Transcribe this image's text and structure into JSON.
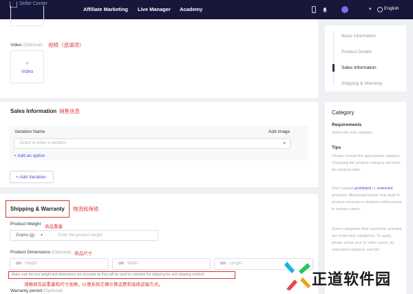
{
  "topnav": {
    "brand": "Seller Center",
    "links": [
      "Affiliate Marketing",
      "Live Manager",
      "Academy"
    ],
    "language": "English"
  },
  "video": {
    "label": "Video",
    "optional": "(Optional)",
    "cn_note": "视频（选填项）",
    "upload_plus": "+",
    "upload_label": "Video"
  },
  "sales": {
    "title": "Sales Information",
    "cn_note": "销售信息",
    "variation_name": "Variation Name",
    "add_image": "Add image",
    "select_placeholder": "Select or enter a variation",
    "add_option": "+ Add an option",
    "add_variation": "+ Add Variation"
  },
  "shipping": {
    "title": "Shipping & Warranty",
    "cn_title": "物流和保修",
    "weight_label": "Product Weight",
    "weight_cn": "商品重量",
    "weight_unit": "Grams (g)",
    "weight_placeholder": "Enter the product weight",
    "dims_label": "Product Dimensions",
    "dims_optional": "(Optional)",
    "dims_cn": "商品尺寸",
    "unit": "cm",
    "height": "Height",
    "width": "Width",
    "length": "Length",
    "warning": "Make sure the box weight and dimensions are accurate as they will be used to calculate the shipping fee and shipping method.",
    "warning_cn": "请确保包装重量和尺寸准确，以便系统正确计算运费和选择运输方式。",
    "warranty_label": "Warranty period",
    "warranty_optional": "(Optional)"
  },
  "steps": {
    "items": [
      "Basic information",
      "Product Details",
      "Sales Information",
      "Shipping & Warranty"
    ],
    "active_index": 2
  },
  "category_panel": {
    "title": "Category",
    "requirements_title": "Requirements",
    "requirements_text": "Select the sub-category.",
    "tips_title": "Tips",
    "tip1": "Please choose the appropriate category. Changing the product category will reset the product data.",
    "tip2_a": "Don't upload ",
    "tip2_prohibited": "prohibited",
    "tip2_b": " or ",
    "tip2_restricted": "restricted",
    "tip2_c": " products. Miscategorisation may lead to product removal or violation enforcement in serious cases.",
    "tip3": "Some categories that cannot be selected are invite-only categories. To apply, please email your (i) seller name, (ii) requested category, and (iii)"
  },
  "watermark": {
    "text": "正道软件园"
  }
}
